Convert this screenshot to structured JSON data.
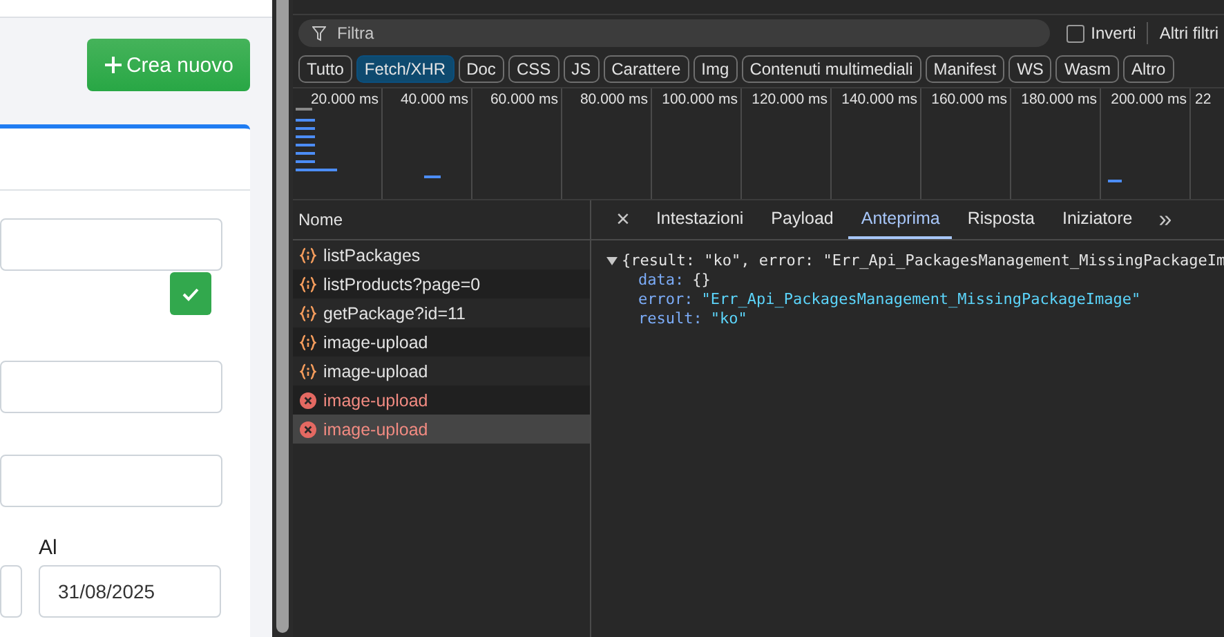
{
  "page": {
    "create_button": "Crea nuovo",
    "date_label": "Al",
    "date_value": "31/08/2025",
    "confirm_checked": true
  },
  "devtools": {
    "filter": {
      "placeholder": "Filtra"
    },
    "invert": {
      "label": "Inverti",
      "checked": false
    },
    "more_filters": "Altri filtri",
    "type_filters": [
      {
        "label": "Tutto",
        "selected": false
      },
      {
        "label": "Fetch/XHR",
        "selected": true
      },
      {
        "label": "Doc",
        "selected": false
      },
      {
        "label": "CSS",
        "selected": false
      },
      {
        "label": "JS",
        "selected": false
      },
      {
        "label": "Carattere",
        "selected": false
      },
      {
        "label": "Img",
        "selected": false
      },
      {
        "label": "Contenuti multimediali",
        "selected": false
      },
      {
        "label": "Manifest",
        "selected": false
      },
      {
        "label": "WS",
        "selected": false
      },
      {
        "label": "Wasm",
        "selected": false
      },
      {
        "label": "Altro",
        "selected": false
      }
    ],
    "timeline_ticks": [
      "20.000 ms",
      "40.000 ms",
      "60.000 ms",
      "80.000 ms",
      "100.000 ms",
      "120.000 ms",
      "140.000 ms",
      "160.000 ms",
      "180.000 ms",
      "200.000 ms",
      "22"
    ],
    "requests_header": "Nome",
    "requests": [
      {
        "name": "listPackages",
        "kind": "fetch",
        "selected": false
      },
      {
        "name": "listProducts?page=0",
        "kind": "fetch",
        "selected": false
      },
      {
        "name": "getPackage?id=11",
        "kind": "fetch",
        "selected": false
      },
      {
        "name": "image-upload",
        "kind": "fetch",
        "selected": false
      },
      {
        "name": "image-upload",
        "kind": "fetch",
        "selected": false
      },
      {
        "name": "image-upload",
        "kind": "error",
        "selected": false
      },
      {
        "name": "image-upload",
        "kind": "error",
        "selected": true
      }
    ],
    "close": "×",
    "tabs": [
      {
        "label": "Intestazioni",
        "selected": false
      },
      {
        "label": "Payload",
        "selected": false
      },
      {
        "label": "Anteprima",
        "selected": true
      },
      {
        "label": "Risposta",
        "selected": false
      },
      {
        "label": "Iniziatore",
        "selected": false
      }
    ],
    "more_tabs": "»",
    "preview": {
      "summary": "{result: \"ko\", error: \"Err_Api_PackagesManagement_MissingPackageIm",
      "expanded": true,
      "fields": [
        {
          "key": "data:",
          "value": "{}",
          "kind": "object"
        },
        {
          "key": "error:",
          "value": "\"Err_Api_PackagesManagement_MissingPackageImage\"",
          "kind": "string"
        },
        {
          "key": "result:",
          "value": "\"ko\"",
          "kind": "string"
        }
      ]
    }
  }
}
